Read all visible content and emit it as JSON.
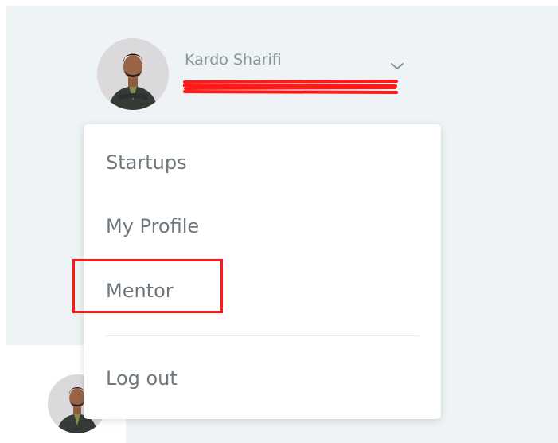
{
  "user": {
    "name": "Kardo Sharifi",
    "avatar_icon": "user-avatar-photo",
    "dropdown_icon": "chevron-down-icon"
  },
  "menu": {
    "items": [
      {
        "label": "Startups"
      },
      {
        "label": "My Profile"
      },
      {
        "label": "Mentor"
      }
    ],
    "logout_label": "Log out"
  },
  "colors": {
    "background": "#eef3f5",
    "menu_text": "#6e787e",
    "name_text": "#8b9499",
    "highlight": "#ff1a1a",
    "redaction": "#ff1a1a"
  }
}
